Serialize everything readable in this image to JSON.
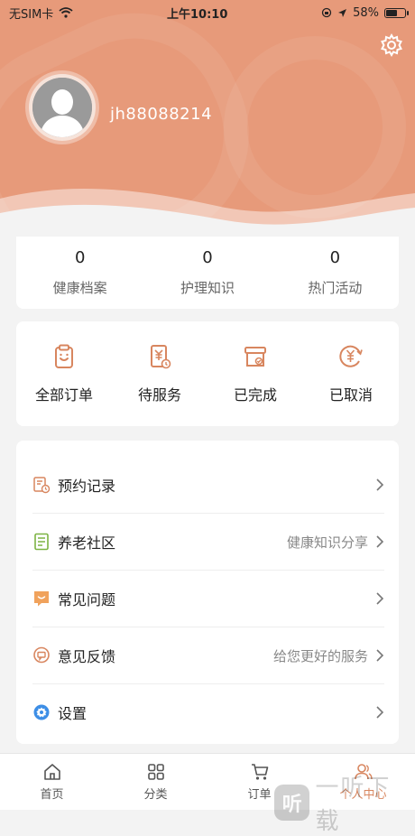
{
  "status_bar": {
    "carrier": "无SIM卡",
    "time": "上午10:10",
    "battery": "58%",
    "battery_level": 0.58
  },
  "profile": {
    "username": "jh88088214"
  },
  "stats": [
    {
      "value": "0",
      "label": "健康档案"
    },
    {
      "value": "0",
      "label": "护理知识"
    },
    {
      "value": "0",
      "label": "热门活动"
    }
  ],
  "orders": [
    {
      "label": "全部订单",
      "icon": "clipboard-icon"
    },
    {
      "label": "待服务",
      "icon": "yen-receipt-icon"
    },
    {
      "label": "已完成",
      "icon": "box-check-icon"
    },
    {
      "label": "已取消",
      "icon": "yen-cancel-icon"
    }
  ],
  "menu": [
    {
      "label": "预约记录",
      "hint": "",
      "icon": "appointment-icon"
    },
    {
      "label": "养老社区",
      "hint": "健康知识分享",
      "icon": "document-icon"
    },
    {
      "label": "常见问题",
      "hint": "",
      "icon": "faq-icon"
    },
    {
      "label": "意见反馈",
      "hint": "给您更好的服务",
      "icon": "feedback-icon"
    },
    {
      "label": "设置",
      "hint": "",
      "icon": "settings-icon"
    }
  ],
  "tabs": [
    {
      "label": "首页",
      "icon": "home-icon"
    },
    {
      "label": "分类",
      "icon": "category-icon"
    },
    {
      "label": "订单",
      "icon": "cart-icon"
    },
    {
      "label": "个人中心",
      "icon": "user-icon"
    }
  ],
  "watermark": {
    "badge": "听",
    "text": "一听下载"
  },
  "colors": {
    "header": "#e79a7a",
    "accent": "#d8865f",
    "background": "#f3f3f3"
  }
}
